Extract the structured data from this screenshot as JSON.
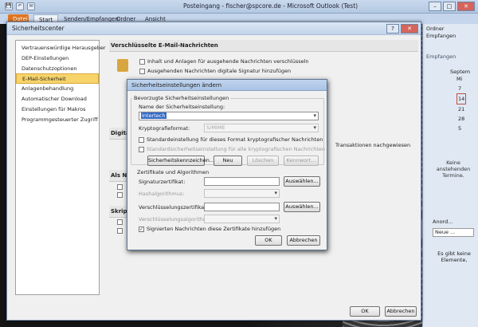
{
  "window": {
    "title": "Posteingang - fischer@spcore.de - Microsoft Outlook (Test)"
  },
  "qat": {
    "save": "💾",
    "undo": "↶",
    "send": "✉"
  },
  "ribbon": {
    "tabs": [
      "Datei",
      "Start",
      "Senden/Empfangen",
      "Ordner",
      "Ansicht"
    ]
  },
  "right_pane": {
    "ribbon_text_1": "Ordner",
    "ribbon_text_2": "Empfangen",
    "ribbon_group": "Empfangen",
    "calendar_month": "Septem",
    "calendar_day_header": "Mi",
    "calendar_days": [
      "7",
      "14",
      "21",
      "28",
      "5"
    ],
    "today": "14",
    "no_appointments": "Keine anstehenden Termine.",
    "arrange": "Anord...",
    "new": "Neue ...",
    "no_items": "Es gibt keine Elemente,"
  },
  "trust_center": {
    "title": "Sicherheitscenter",
    "help": "?",
    "nav": [
      "Vertrauenswürdige Herausgeber",
      "DEP-Einstellungen",
      "Datenschutzoptionen",
      "E-Mail-Sicherheit",
      "Anlagenbehandlung",
      "Automatischer Download",
      "Einstellungen für Makros",
      "Programmgesteuerter Zugriff"
    ],
    "selected_nav": "E-Mail-Sicherheit",
    "section_encrypted": "Verschlüsselte E-Mail-Nachrichten",
    "chk_encrypt": "Inhalt und Anlagen für ausgehende Nachrichten verschlüsseln",
    "chk_sign": "Ausgehenden Nachrichten digitale Signatur hinzufügen",
    "section_digital": "Digita",
    "tx_text": "Transaktionen nachgewiesen",
    "section_plain": "Als N",
    "section_script": "Skript",
    "ok": "OK",
    "cancel": "Abbrechen"
  },
  "security_settings": {
    "title": "Sicherheitseinstellungen ändern",
    "group_preferred": "Bevorzugte Sicherheitseinstellungen",
    "name_label": "Name der Sicherheitseinstellung:",
    "name_value": "Intertech",
    "format_label": "Kryptografieformat:",
    "format_value": "S/MIME",
    "chk_default_format": "Standardeinstellung für dieses Format kryptografischer Nachrichten",
    "chk_default_all": "Standardsicherheitseinstellung für alle kryptografischen Nachrichten",
    "btn_labels": "Sicherheitskennzeichen...",
    "btn_new": "Neu",
    "btn_delete": "Löschen",
    "btn_password": "Kennwort...",
    "group_certs": "Zertifikate und Algorithmen",
    "sign_cert_label": "Signaturzertifikat:",
    "hash_label": "Hashalgorithmus:",
    "enc_cert_label": "Verschlüsselungszertifikat:",
    "enc_alg_label": "Verschlüsselungsalgorithmus:",
    "choose": "Auswählen...",
    "chk_send_certs": "Signierten Nachrichten diese Zertifikate hinzufügen",
    "ok": "OK",
    "cancel": "Abbrechen"
  }
}
